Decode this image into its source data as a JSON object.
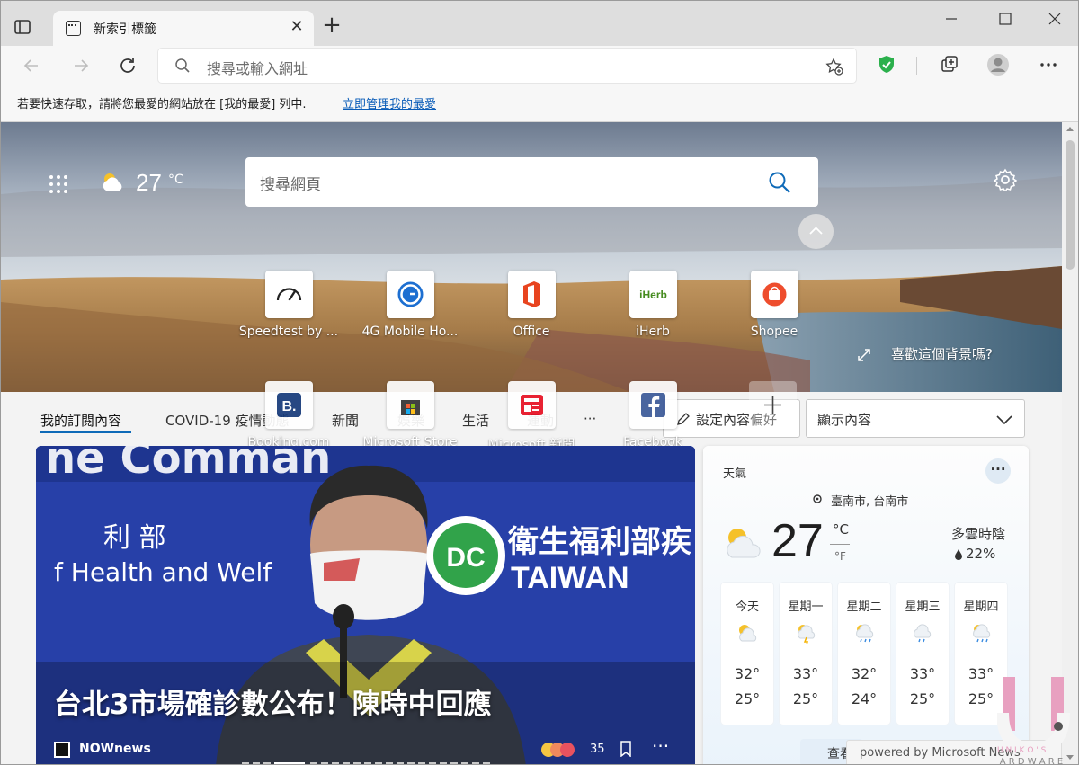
{
  "browser": {
    "tab_title": "新索引標籤",
    "address_placeholder": "搜尋或輸入網址",
    "favorites_hint": "若要快速存取，請將您最愛的網站放在 [我的最愛] 列中.",
    "favorites_link": "立即管理我的最愛"
  },
  "newtab": {
    "weather_mini": {
      "temp": "27",
      "unit": "°C"
    },
    "search_placeholder": "搜尋網頁",
    "quick_links_row1": [
      {
        "label": "Speedtest by ...",
        "icon": "speedometer-icon"
      },
      {
        "label": "4G Mobile Ho...",
        "icon": "4g-icon"
      },
      {
        "label": "Office",
        "icon": "office-icon"
      },
      {
        "label": "iHerb",
        "icon": "iherb-icon"
      },
      {
        "label": "Shopee",
        "icon": "shopee-icon"
      }
    ],
    "quick_links_row2": [
      {
        "label": "Booking.com",
        "icon": "booking-icon"
      },
      {
        "label": "Microsoft Store",
        "icon": "store-icon"
      },
      {
        "label": "Microsoft 新聞",
        "icon": "news-icon"
      },
      {
        "label": "Facebook",
        "icon": "facebook-icon"
      }
    ],
    "like_background": "喜歡這個背景嗎?"
  },
  "feed": {
    "tabs": [
      "我的訂閱內容",
      "COVID-19 疫情動態",
      "新聞",
      "娛樂",
      "生活",
      "運動",
      "···"
    ],
    "personalize_label": "設定內容偏好",
    "display_label": "顯示內容"
  },
  "news": {
    "headline": "台北3市場確診數公布！陳時中回應",
    "source": "NOWnews",
    "reactions_count": "35",
    "photo_text_1": "利 部",
    "photo_text_2": "f Health and Welf",
    "photo_text_3": "衛生福利部疾",
    "photo_text_4": "TAIWAN",
    "photo_text_5": "ne Comman"
  },
  "weather": {
    "title": "天氣",
    "location": "臺南市, 台南市",
    "temp": "27",
    "unit_c": "°C",
    "unit_f": "°F",
    "condition": "多雲時陰",
    "precip": "22%",
    "forecast": [
      {
        "day": "今天",
        "hi": "32°",
        "lo": "25°"
      },
      {
        "day": "星期一",
        "hi": "33°",
        "lo": "25°"
      },
      {
        "day": "星期二",
        "hi": "32°",
        "lo": "24°"
      },
      {
        "day": "星期三",
        "hi": "33°",
        "lo": "25°"
      },
      {
        "day": "星期四",
        "hi": "33°",
        "lo": "25°"
      }
    ],
    "more_button": "···",
    "more_link": "查看"
  },
  "footer": {
    "powered_by": "powered by Microsoft News",
    "watermark_1": "U N I K O ' S",
    "watermark_2": "H A R D W A R E"
  },
  "colors": {
    "accent": "#0e6ab8",
    "shield": "#2bb04c",
    "news_bg": "#2740a8"
  }
}
